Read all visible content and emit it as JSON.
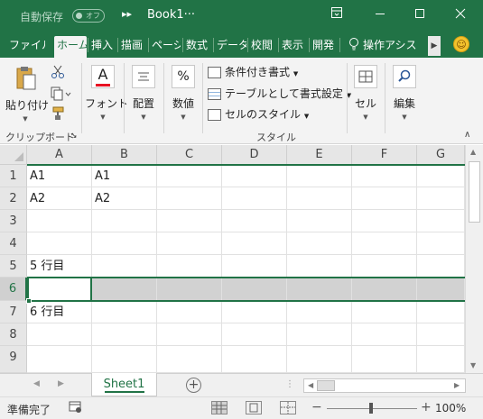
{
  "titlebar": {
    "autosave_label": "自動保存",
    "autosave_state": "オフ",
    "qat_more": "▸▸",
    "document_title": "Book1···",
    "ribbon_display_icon": "ribbon-display-options-icon",
    "minimize_icon": "minimize-icon",
    "maximize_icon": "maximize-icon",
    "close_icon": "close-icon"
  },
  "tabs": [
    {
      "label": "ファイル"
    },
    {
      "label": "ホーム",
      "active": true
    },
    {
      "label": "挿入"
    },
    {
      "label": "描画"
    },
    {
      "label": "ページ"
    },
    {
      "label": "数式"
    },
    {
      "label": "データ"
    },
    {
      "label": "校閲"
    },
    {
      "label": "表示"
    },
    {
      "label": "開発"
    },
    {
      "label": "操作アシス"
    }
  ],
  "ribbon": {
    "paste_label": "貼り付け",
    "font_label": "フォント",
    "alignment_label": "配置",
    "number_label": "数値",
    "number_icon_text": "%",
    "font_icon_text": "A",
    "conditional_format": "条件付き書式",
    "format_as_table": "テーブルとして書式設定",
    "cell_styles": "セルのスタイル",
    "cells_label": "セル",
    "editing_label": "編集",
    "clipboard_group": "クリップボード",
    "styles_group": "スタイル"
  },
  "grid": {
    "columns": [
      "A",
      "B",
      "C",
      "D",
      "E",
      "F",
      "G"
    ],
    "rows": [
      {
        "num": "1",
        "a": "A1",
        "b": "A1"
      },
      {
        "num": "2",
        "a": "A2",
        "b": "A2"
      },
      {
        "num": "3",
        "a": "",
        "b": ""
      },
      {
        "num": "4",
        "a": "",
        "b": ""
      },
      {
        "num": "5",
        "a": "5 行目",
        "b": ""
      },
      {
        "num": "6",
        "a": "",
        "b": ""
      },
      {
        "num": "7",
        "a": "6 行目",
        "b": ""
      },
      {
        "num": "8",
        "a": "",
        "b": ""
      },
      {
        "num": "9",
        "a": "",
        "b": ""
      }
    ],
    "selected_row": "6"
  },
  "sheets": [
    {
      "label": "Sheet1",
      "active": true
    }
  ],
  "statusbar": {
    "status": "準備完了",
    "zoom": "100%"
  },
  "colors": {
    "accent": "#217346",
    "selection": "#d2d2d2"
  }
}
